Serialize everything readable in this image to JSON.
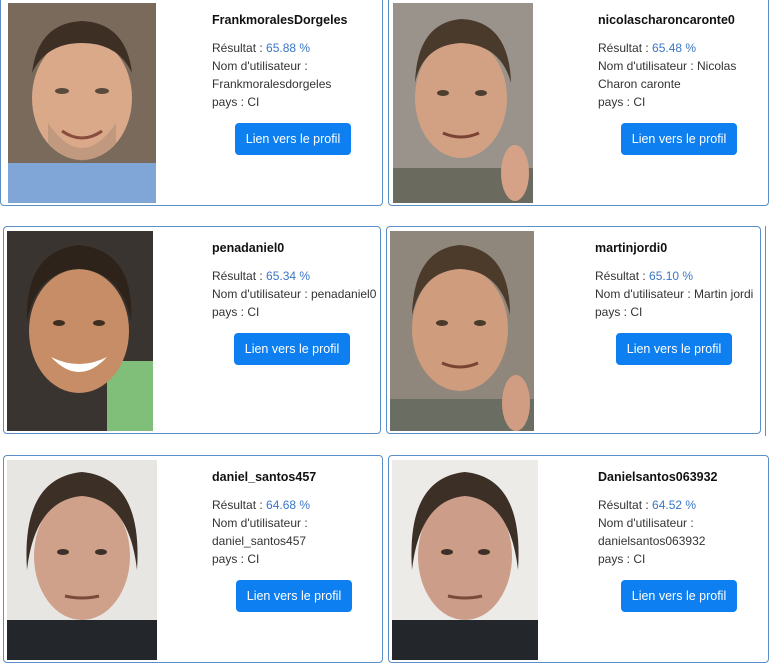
{
  "labels": {
    "result": "Résultat : ",
    "username": "Nom d'utilisateur",
    "country": "pays : ",
    "button": "Lien vers le profil"
  },
  "cards": [
    {
      "title": "FrankmoralesDorgeles",
      "score": "65.88 %",
      "user_line1": "Nom d'utilisateur :",
      "user_line2": "Frankmoralesdorgeles",
      "country": "CI"
    },
    {
      "title": "nicolascharoncaronte0",
      "score": "65.48 %",
      "user_line1": "Nom d'utilisateur : Nicolas",
      "user_line2": "Charon caronte",
      "country": "CI"
    },
    {
      "title": "penadaniel0",
      "score": "65.34 %",
      "user_line1": "Nom d'utilisateur : penadaniel0",
      "user_line2": "",
      "country": "CI"
    },
    {
      "title": "martinjordi0",
      "score": "65.10 %",
      "user_line1": "Nom d'utilisateur : Martin jordi",
      "user_line2": "",
      "country": "CI"
    },
    {
      "title": "daniel_santos457",
      "score": "64.68 %",
      "user_line1": "Nom d'utilisateur :",
      "user_line2": "daniel_santos457",
      "country": "CI"
    },
    {
      "title": "Danielsantos063932",
      "score": "64.52 %",
      "user_line1": "Nom d'utilisateur :",
      "user_line2": "danielsantos063932",
      "country": "CI"
    }
  ]
}
